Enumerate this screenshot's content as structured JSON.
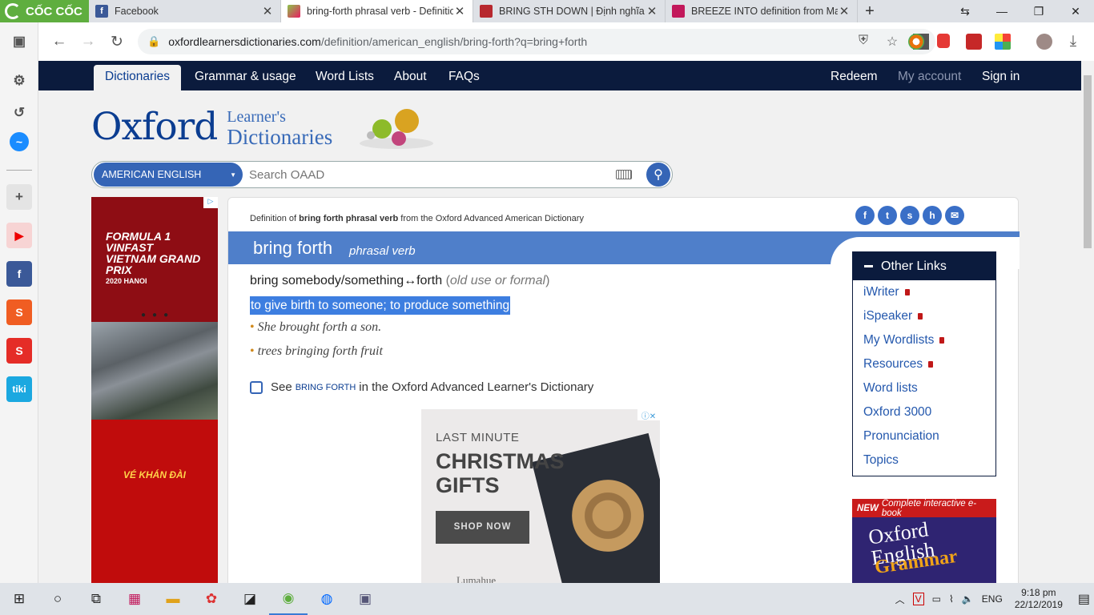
{
  "browser": {
    "brand": "CỐC CỐC",
    "tabs": [
      {
        "title": "Facebook",
        "icon": "facebook-icon",
        "active": false
      },
      {
        "title": "bring-forth phrasal verb - Definitio",
        "icon": "oxford-icon",
        "active": true
      },
      {
        "title": "BRING STH DOWN | Định nghĩa tro",
        "icon": "cambridge-icon",
        "active": false
      },
      {
        "title": "BREEZE INTO definition from Macr",
        "icon": "macmillan-icon",
        "active": false
      }
    ],
    "url_domain": "oxfordlearnersdictionaries.com",
    "url_path": "/definition/american_english/bring-forth?q=bring+forth"
  },
  "site": {
    "nav": {
      "dictionaries": "Dictionaries",
      "grammar": "Grammar & usage",
      "wordlists": "Word Lists",
      "about": "About",
      "faqs": "FAQs",
      "redeem": "Redeem",
      "myaccount": "My account",
      "signin": "Sign in"
    },
    "logo": {
      "oxford": "Oxford",
      "learners": "Learner's",
      "dictionaries": "Dictionaries"
    },
    "search": {
      "dictionary": "AMERICAN ENGLISH",
      "placeholder": "Search OAAD"
    }
  },
  "ad_left": {
    "headline": "FORMULA 1 VINFAST VIETNAM GRAND PRIX",
    "year": "2020",
    "city": "HANOI",
    "cta": "VÉ KHÁN ĐÀI"
  },
  "entry": {
    "def_prefix": "Definition of",
    "def_word": "bring forth phrasal verb",
    "def_suffix": "from the Oxford Advanced American Dictionary",
    "headword": "bring forth",
    "pos": "phrasal verb",
    "sense_pattern": "bring somebody/something↔forth",
    "register": "old use or formal",
    "definition": "to give birth to someone; to produce something",
    "examples": [
      "She brought forth a son.",
      "trees bringing forth fruit"
    ],
    "see_prefix": "See",
    "see_word": "BRING FORTH",
    "see_suffix": "in the Oxford Advanced Learner's Dictionary"
  },
  "ad_center": {
    "line1": "LAST MINUTE",
    "line2": "CHRISTMAS",
    "line3": "GIFTS",
    "button": "SHOP NOW",
    "brand": "Lumahue"
  },
  "other_links": {
    "title": "Other Links",
    "items": [
      "iWriter",
      "iSpeaker",
      "My Wordlists",
      "Resources",
      "Word lists",
      "Oxford 3000",
      "Pronunciation",
      "Topics"
    ]
  },
  "grammar_ad": {
    "new": "NEW",
    "tag": "Complete interactive e-book",
    "title1": "Oxford",
    "title2": "English",
    "title3": "Grammar"
  },
  "taskbar": {
    "lang": "ENG",
    "time": "9:18 pm",
    "date": "22/12/2019"
  },
  "colors": {
    "navy": "#0b1b3d",
    "accent": "#3565b6",
    "brand_green": "#5fae3f"
  }
}
